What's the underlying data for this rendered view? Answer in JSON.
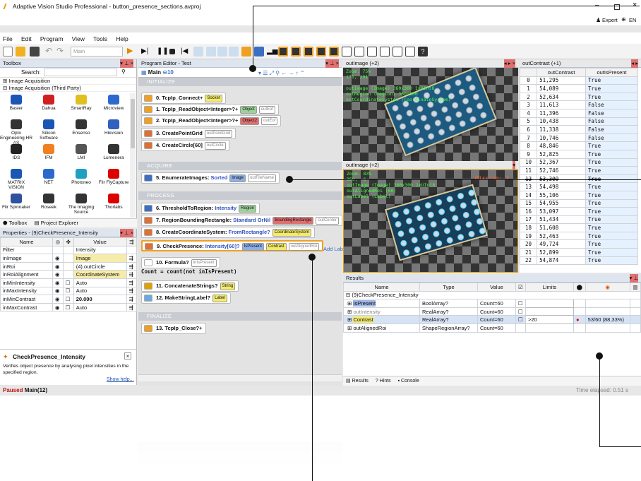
{
  "window": {
    "title": "Adaptive Vision Studio Professional - button_presence_sections.avproj",
    "user": "Expert",
    "lang": "EN"
  },
  "menu": [
    "File",
    "Edit",
    "Program",
    "View",
    "Tools",
    "Help"
  ],
  "toolbar": {
    "program_select": "Main"
  },
  "toolbox": {
    "title": "Toolbox",
    "search_label": "Search:",
    "categories": [
      "Image Acquisition",
      "Image Acquisition (Third Party)"
    ],
    "vendors": [
      [
        "Basler",
        "Dahua",
        "SmartRay",
        "Microview"
      ],
      [
        "Opto Engineering HR AS",
        "Silicon Software",
        "Ensenso",
        "Hikvision"
      ],
      [
        "IDS",
        "IFM",
        "LMI",
        "Lumenera"
      ],
      [
        "MATRIX VISION",
        "NET",
        "Photoneo",
        "Flir FlyCapture"
      ],
      [
        "Flir Spinnaker",
        "Roseek",
        "The Imaging Source",
        "Thorlabs"
      ]
    ],
    "tabs": [
      "Toolbox",
      "Project Explorer"
    ]
  },
  "properties": {
    "title": "Properties - (9)CheckPresence_Intensity",
    "headers": [
      "Name",
      "Value"
    ],
    "rows": [
      {
        "name": "Filter",
        "value": "Intensity"
      },
      {
        "name": "inImage",
        "value": "Image"
      },
      {
        "name": "inRoi",
        "value": "(4).outCircle"
      },
      {
        "name": "inRoiAlignment",
        "value": "CoordinateSystem"
      },
      {
        "name": "inMinIntensity",
        "value": "Auto"
      },
      {
        "name": "inMaxIntensity",
        "value": "Auto"
      },
      {
        "name": "inMinContrast",
        "value": "20.000"
      },
      {
        "name": "inMaxContrast",
        "value": "Auto"
      }
    ],
    "help_title": "CheckPresence_Intensity",
    "help_text": "Verifies object presence by analysing pixel intensities in the specified region.",
    "help_link": "Show help..."
  },
  "editor": {
    "title": "Program Editor - Test",
    "macro": "Main",
    "macro_count": "10",
    "sections": [
      "INITIALIZE",
      "ACQUIRE",
      "PROCESS",
      "FINALIZE"
    ],
    "nodes": [
      {
        "n": "0. TcpIp_Connect",
        "suffix": "+",
        "chips": [
          "Socket"
        ]
      },
      {
        "n": "1. TcpIp_ReadObject<Integer>?",
        "suffix": "+",
        "chips": [
          "Object",
          "outEof"
        ]
      },
      {
        "n": "2. TcpIp_ReadObject<Integer>?",
        "suffix": "+",
        "chips": [
          "Object2",
          "outEof"
        ]
      },
      {
        "n": "3. CreatePointGrid",
        "suffix": "",
        "chips": [
          "outPointGrid"
        ]
      },
      {
        "n": "4. CreateCircle[60]",
        "suffix": "",
        "chips": [
          "outCircle"
        ]
      },
      {
        "n": "5. EnumerateImages: ",
        "kw": "Sorted",
        "chips": [
          "Image",
          "outFileName"
        ]
      },
      {
        "n": "6. ThresholdToRegion: ",
        "kw": "Intensity",
        "chips": [
          "Region"
        ]
      },
      {
        "n": "7. RegionBoundingRectangle: ",
        "kw": "Standard OrNil",
        "chips": [
          "BoundingRectangle",
          "outCenter"
        ]
      },
      {
        "n": "8. CreateCoordinateSystem: ",
        "kw": "FromRectangle?",
        "chips": [
          "CoordinateSystem"
        ]
      },
      {
        "n": "9. CheckPresence: ",
        "kw": "Intensity[60]?",
        "chips": [
          "IsPresent",
          "Contrast",
          "outAlignedRoi"
        ]
      },
      {
        "n": "10. Formula?",
        "suffix": "",
        "chips": [
          "inIsPresent"
        ]
      },
      {
        "n": "11. ConcatenateStrings?",
        "suffix": "",
        "chips": [
          "String"
        ]
      },
      {
        "n": "12. MakeStringLabel?",
        "suffix": "",
        "chips": [
          "Label"
        ]
      },
      {
        "n": "13. TcpIp_Close?",
        "suffix": "+",
        "chips": []
      }
    ],
    "formula": "Count = count(not inIsPresent)",
    "add_label": "Add Lab"
  },
  "view1": {
    "tab": "outImage (+2)",
    "zoom": "Zoom: 75%",
    "coords": "171, 291",
    "layers": [
      "outImage (Image) 360x300 1xUInt8",
      "outRegion (Region) 360x300",
      "outCoordinateSystem (CoordinateSystem)"
    ]
  },
  "view2": {
    "tab": "outImage (+2)",
    "zoom": "Zoom: 83%",
    "coords": "359, -6",
    "missing": "Missing: 7",
    "layers": [
      "outImage (Image) 360x300 1xUInt8",
      "outAlignedRoi [60]",
      "outLabel (Label)"
    ]
  },
  "table": {
    "tab": "outContrast (+1)",
    "headers": [
      "",
      "outContrast",
      "outIsPresent"
    ],
    "rows": [
      [
        "0",
        "51,295",
        "True"
      ],
      [
        "1",
        "54,089",
        "True"
      ],
      [
        "2",
        "52,634",
        "True"
      ],
      [
        "3",
        "11,613",
        "False"
      ],
      [
        "4",
        "11,396",
        "False"
      ],
      [
        "5",
        "10,438",
        "False"
      ],
      [
        "6",
        "11,338",
        "False"
      ],
      [
        "7",
        "10,746",
        "False"
      ],
      [
        "8",
        "48,846",
        "True"
      ],
      [
        "9",
        "52,825",
        "True"
      ],
      [
        "10",
        "52,367",
        "True"
      ],
      [
        "11",
        "52,746",
        "True"
      ],
      [
        "12",
        "53,309",
        "True"
      ],
      [
        "13",
        "54,498",
        "True"
      ],
      [
        "14",
        "55,106",
        "True"
      ],
      [
        "15",
        "54,955",
        "True"
      ],
      [
        "16",
        "53,097",
        "True"
      ],
      [
        "17",
        "51,434",
        "True"
      ],
      [
        "18",
        "51,608",
        "True"
      ],
      [
        "19",
        "52,463",
        "True"
      ],
      [
        "20",
        "49,724",
        "True"
      ],
      [
        "21",
        "52,899",
        "True"
      ],
      [
        "22",
        "54,874",
        "True"
      ]
    ]
  },
  "results": {
    "title": "Results",
    "headers": [
      "Name",
      "Type",
      "Value",
      "Limits"
    ],
    "group": "(9)CheckPresence_Intensity",
    "rows": [
      {
        "name": "IsPresent",
        "type": "BoolArray?",
        "value": "Count=60",
        "limit": "",
        "stat": ""
      },
      {
        "name": "outIntensity",
        "type": "RealArray?",
        "value": "Count=60",
        "limit": "",
        "stat": ""
      },
      {
        "name": "Contrast",
        "type": "RealArray?",
        "value": "Count=60",
        "limit": ">20",
        "stat": "53/60 (88,33%)"
      },
      {
        "name": "outAlignedRoi",
        "type": "ShapeRegionArray?",
        "value": "Count=60",
        "limit": "",
        "stat": ""
      }
    ],
    "tabs": [
      "Results",
      "Hints",
      "Console"
    ]
  },
  "status": {
    "left": "Paused",
    "context": "Main(12)",
    "right": "Time elapsed: 0.51 s"
  },
  "colors": {
    "accent": "#3a6fc4",
    "panel": "#e7e7e7",
    "green": "#41ff41",
    "red_dot": "#e00000"
  }
}
